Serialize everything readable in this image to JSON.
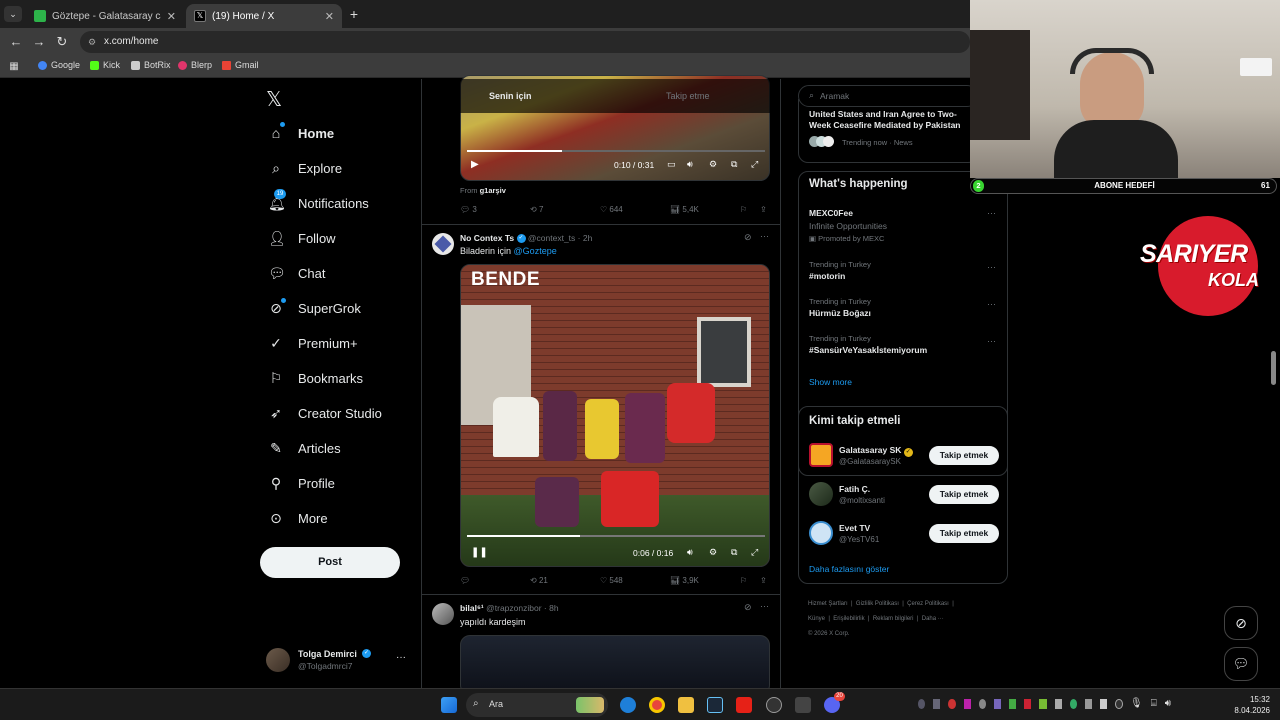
{
  "browser": {
    "tabs": [
      {
        "title": "Göztepe - Galatasaray canlı skor",
        "active": false
      },
      {
        "title": "(19) Home / X",
        "active": true
      }
    ],
    "new_tab": "+",
    "url": "x.com/home",
    "bookmarks": [
      "Google",
      "Kick",
      "BotRix",
      "Blerp",
      "Gmail"
    ]
  },
  "nav": {
    "items": [
      {
        "label": "Home",
        "icon": "home-icon"
      },
      {
        "label": "Explore",
        "icon": "search-icon"
      },
      {
        "label": "Notifications",
        "icon": "bell-icon",
        "badge": "19"
      },
      {
        "label": "Follow",
        "icon": "add-user-icon"
      },
      {
        "label": "Chat",
        "icon": "chat-icon"
      },
      {
        "label": "SuperGrok",
        "icon": "grok-icon"
      },
      {
        "label": "Premium+",
        "icon": "verified-icon"
      },
      {
        "label": "Bookmarks",
        "icon": "bookmark-icon"
      },
      {
        "label": "Creator Studio",
        "icon": "rocket-icon"
      },
      {
        "label": "Articles",
        "icon": "article-icon"
      },
      {
        "label": "Profile",
        "icon": "person-icon"
      },
      {
        "label": "More",
        "icon": "more-circle-icon"
      }
    ],
    "post_label": "Post",
    "account": {
      "name": "Tolga Demirci",
      "handle": "@Tolgadmrci7",
      "more": "···"
    }
  },
  "feed": {
    "tabs": [
      "Senin için",
      "Takip etme"
    ],
    "tweet1": {
      "video_time": "0:10 / 0:31",
      "from_label": "From",
      "from_user": "g1arşiv",
      "actions": {
        "replies": "3",
        "reposts": "7",
        "likes": "644",
        "views": "5,4K"
      }
    },
    "tweet2": {
      "name": "No Contex Ts",
      "handle": "@context_ts",
      "time": "· 2h",
      "text": "Biladerin için",
      "mention": "@Goztepe",
      "overlay_text": "BENDE",
      "video_time": "0:06 / 0:16",
      "actions": {
        "replies": "",
        "reposts": "21",
        "likes": "548",
        "views": "3,9K"
      }
    },
    "tweet3": {
      "name": "bilal⁶¹",
      "handle": "@trapzonzibor",
      "time": "· 8h",
      "text": "yapıldı kardeşim"
    }
  },
  "right": {
    "search_placeholder": "Aramak",
    "top_news": {
      "headline": "United States and Iran Agree to Two-Week Ceasefire Mediated by Pakistan with ...",
      "meta": "Trending now · News"
    },
    "whats_happening": {
      "title": "What's happening",
      "items": [
        {
          "context": "",
          "title": "MEXC0Fee",
          "sub": "Infinite Opportunities",
          "promo": "Promoted by MEXC"
        },
        {
          "context": "Trending in Turkey",
          "title": "#motorin"
        },
        {
          "context": "Trending in Turkey",
          "title": "Hürmüz Boğazı"
        },
        {
          "context": "Trending in Turkey",
          "title": "#SansürVeYasakİstemiyorum"
        }
      ],
      "show_more": "Show more"
    },
    "who_to_follow": {
      "title": "Kimi takip etmeli",
      "items": [
        {
          "name": "Galatasaray SK",
          "handle": "@GalatasaraySK",
          "button": "Takip etmek"
        },
        {
          "name": "Fatih Ç.",
          "handle": "@moltixsanti",
          "button": "Takip etmek"
        },
        {
          "name": "Evet TV",
          "handle": "@YesTV61",
          "button": "Takip etmek"
        }
      ],
      "show_more": "Daha fazlasını göster"
    },
    "footer": [
      "Hizmet Şartları",
      "Gizlilik Politikası",
      "Çerez Politikası",
      "Künye",
      "Erişilebilirlik",
      "Reklam bilgileri",
      "Daha ···",
      "© 2026 X Corp."
    ]
  },
  "overlay": {
    "goal_label": "ABONE HEDEFİ",
    "goal_current": "2",
    "goal_target": "61",
    "sponsor_line1": "SARIYER",
    "sponsor_line2": "KOLA"
  },
  "taskbar": {
    "search": "Ara",
    "time": "15:32",
    "date": "8.04.2026",
    "badge": "20"
  },
  "colors": {
    "accent": "#1d9bf0",
    "bg": "#000000",
    "border": "#2f3336",
    "muted": "#71767b"
  }
}
